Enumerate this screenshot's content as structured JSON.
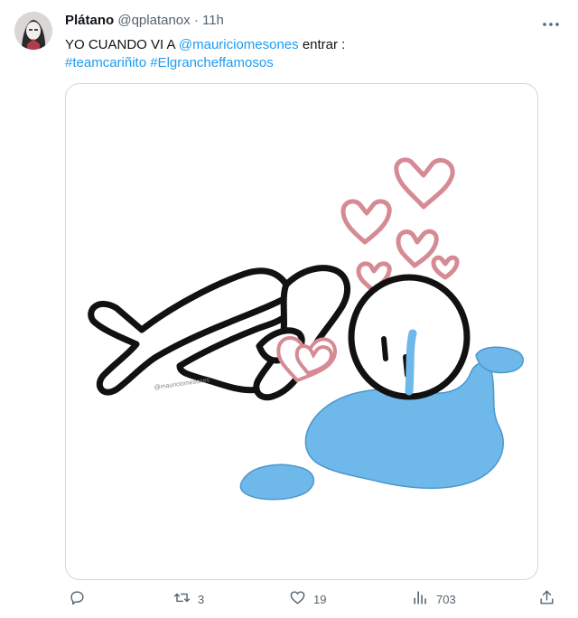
{
  "tweet": {
    "display_name": "Plátano",
    "handle": "@qplatanox",
    "separator": "·",
    "time": "11h",
    "text_prefix": "YO CUANDO VI A ",
    "mention": "@mauriciomesones",
    "text_suffix": " entrar :",
    "hashtags": [
      "#teamcariñito",
      "#Elgrancheffamosos"
    ],
    "media_watermark": "@mauriciomesones"
  },
  "actions": {
    "reply_icon": "reply-icon",
    "retweet_icon": "retweet-icon",
    "retweet_count": "3",
    "like_icon": "heart-icon",
    "like_count": "19",
    "views_icon": "views-icon",
    "views_count": "703",
    "share_icon": "share-icon"
  },
  "colors": {
    "link": "#1d9bf0",
    "muted": "#536471",
    "heart_pink": "#d58a94",
    "puddle_blue": "#6fb8ea",
    "text": "#0f1419"
  }
}
